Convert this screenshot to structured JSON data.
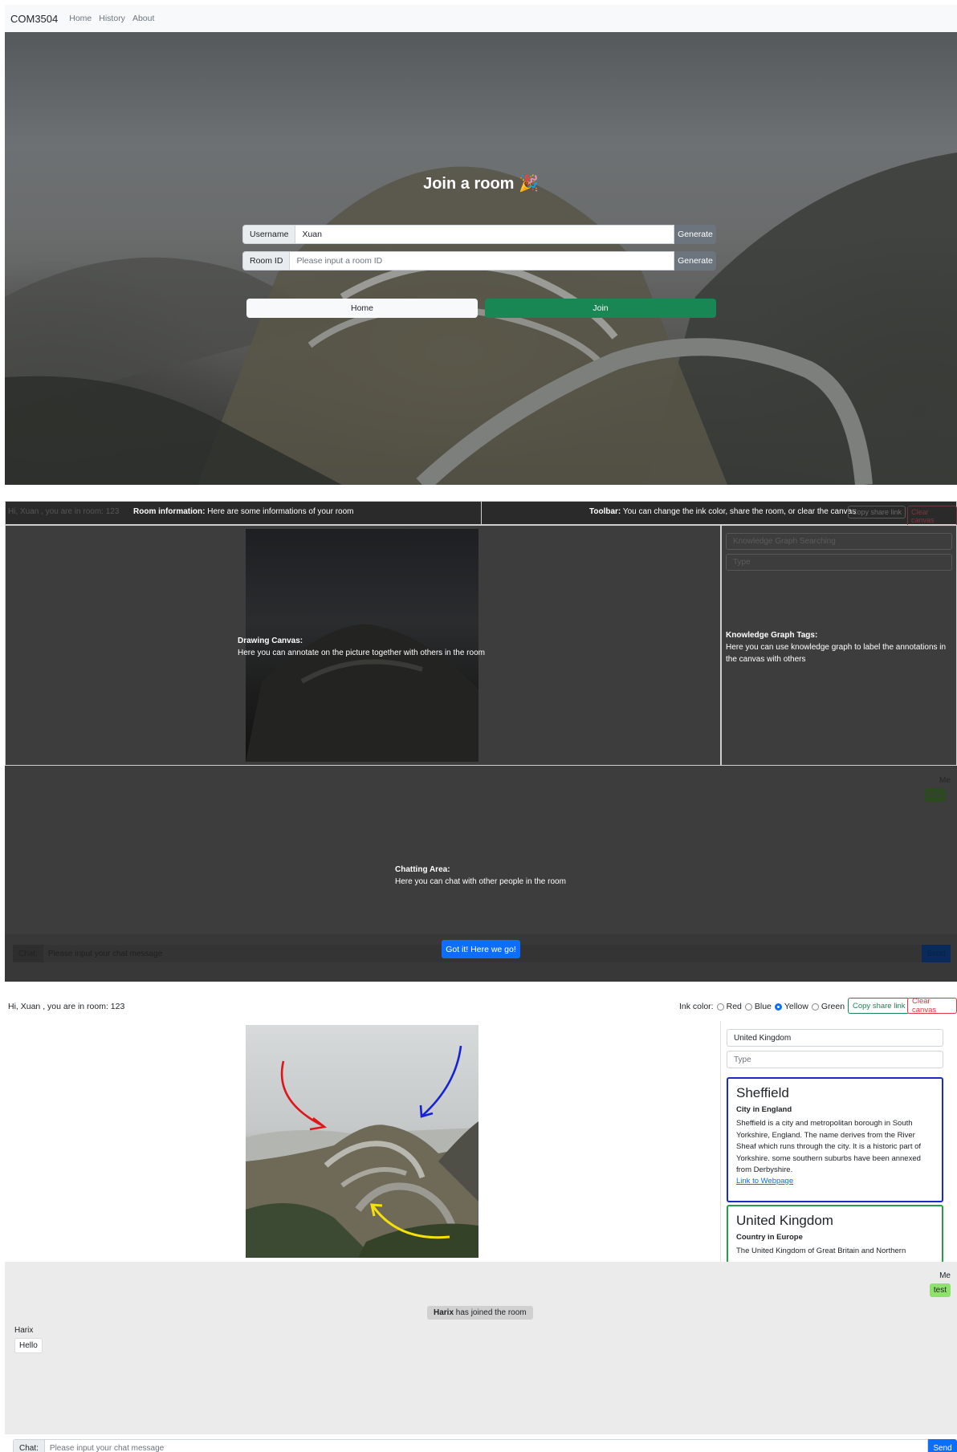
{
  "join_page": {
    "brand": "COM3504",
    "nav": [
      "Home",
      "History",
      "About"
    ],
    "title": "Join a room 🎉",
    "username_label": "Username",
    "username_value": "Xuan",
    "roomid_label": "Room ID",
    "roomid_placeholder": "Please input a room ID",
    "generate_label": "Generate",
    "home_button": "Home",
    "join_button": "Join"
  },
  "tour": {
    "greeting": "Hi, Xuan , you are in room: 123",
    "room_info_title": "Room information:",
    "room_info_text": " Here are some informations of your room",
    "toolbar_title": "Toolbar:",
    "toolbar_text": " You can change the ink color, share the room, or clear the canvas",
    "copy_share_link": "Copy share link",
    "clear_canvas": "Clear canvas",
    "kg_search_placeholder": "Knowledge Graph Searching",
    "type_placeholder": "Type",
    "canvas_title": "Drawing Canvas:",
    "canvas_text": "Here you can annotate on the picture together with others in the room",
    "kg_title": "Knowledge Graph Tags:",
    "kg_text": "Here you can use knowledge graph to label the annotations in the canvas with others",
    "chat_title": "Chatting Area:",
    "chat_text": "Here you can chat with other people in the room",
    "me_label": "Me",
    "my_message": "test",
    "chat_label": "Chat:",
    "chat_placeholder": "Please input your chat message",
    "send": "Send",
    "got_it": "Got it! Here we go!"
  },
  "room": {
    "greeting": "Hi, Xuan , you are in room: 123",
    "ink_color_label": "Ink color:",
    "ink_options": [
      "Red",
      "Blue",
      "Yellow",
      "Green"
    ],
    "ink_selected": "Yellow",
    "copy_share_link": "Copy share link",
    "clear_canvas": "Clear canvas",
    "kg_search_value": "United Kingdom",
    "type_placeholder": "Type",
    "cards": [
      {
        "title": "Sheffield",
        "subtitle": "City in England",
        "description": "Sheffield is a city and metropolitan borough in South Yorkshire, England. The name derives from the River Sheaf which runs through the city. It is a historic part of Yorkshire. some southern suburbs have been annexed from Derbyshire.",
        "link": "Link to Webpage",
        "border_color": "#1b2bc9"
      },
      {
        "title": "United Kingdom",
        "subtitle": "Country in Europe",
        "description": "The United Kingdom of Great Britain and Northern",
        "border_color": "#23a14a"
      }
    ],
    "chat": {
      "me_label": "Me",
      "my_message": "test",
      "system_user": "Harix",
      "system_text": " has joined the room",
      "other_name": "Harix",
      "other_message": "Hello",
      "chat_label": "Chat:",
      "chat_placeholder": "Please input your chat message",
      "send": "Send"
    }
  },
  "colors": {
    "primary": "#0d6efd",
    "success": "#198754",
    "danger": "#dc3545",
    "secondary": "#6c757d",
    "arrow_red": "#e0141a",
    "arrow_blue": "#1522d9",
    "arrow_yellow": "#f5e00a"
  }
}
